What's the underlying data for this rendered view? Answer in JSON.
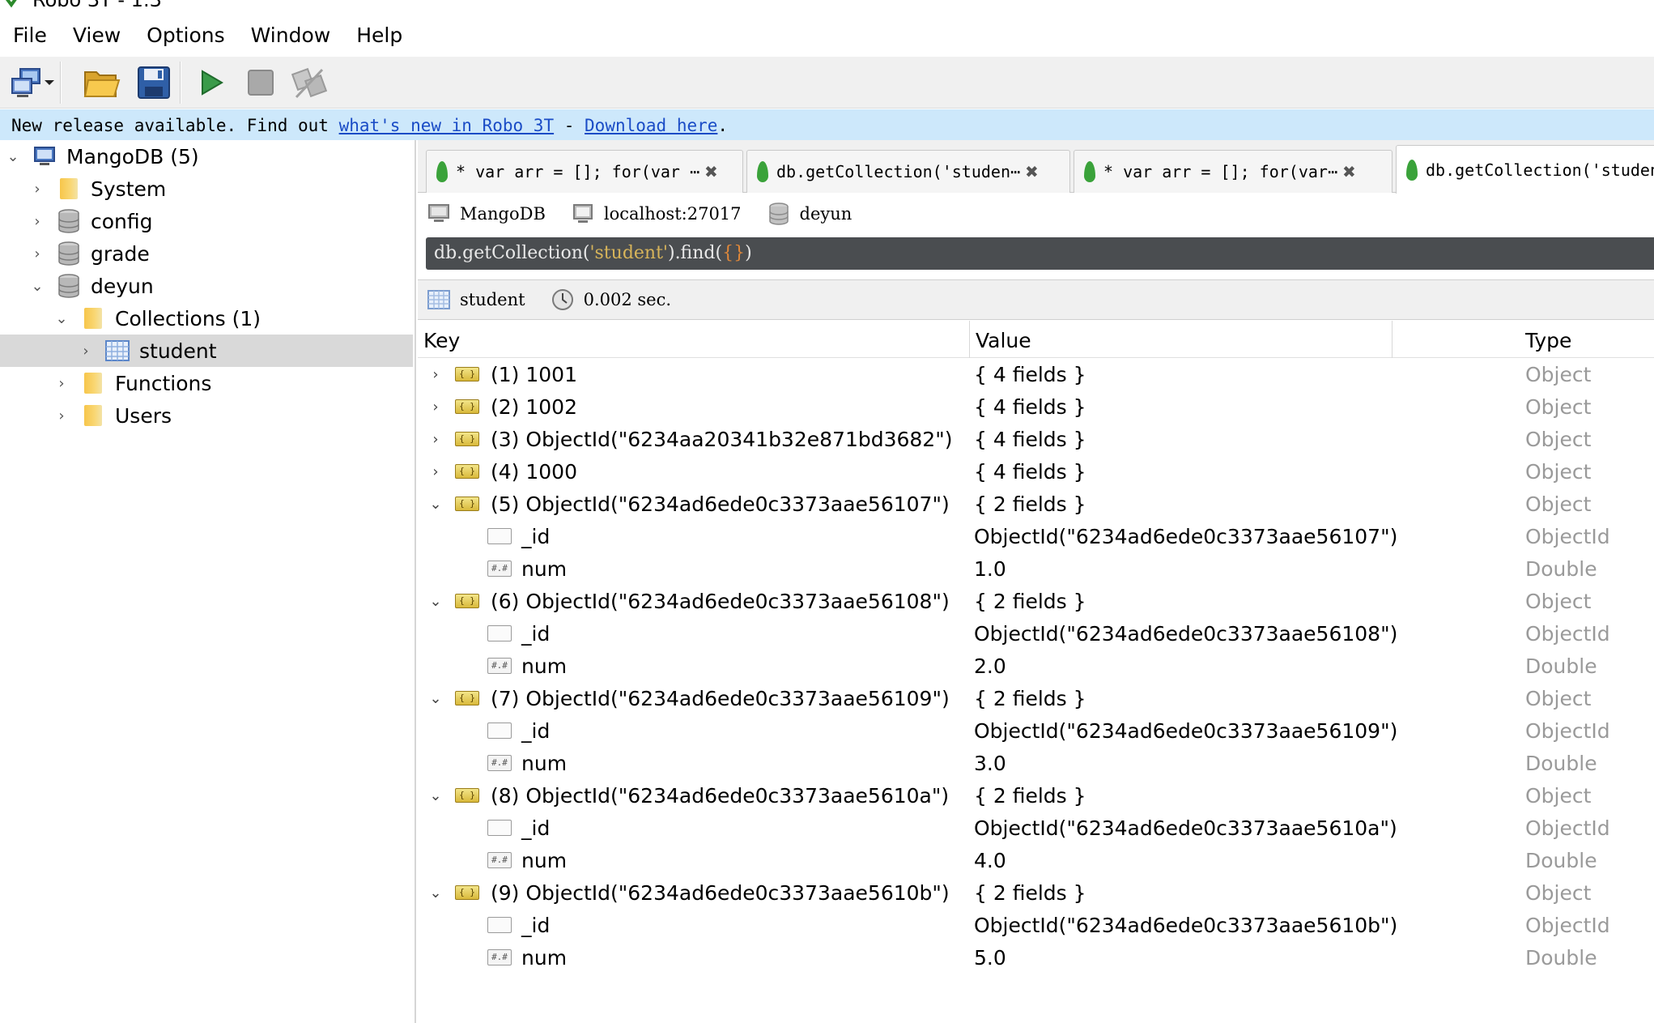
{
  "window": {
    "title": "Robo 3T - 1.3"
  },
  "menu": [
    "File",
    "View",
    "Options",
    "Window",
    "Help"
  ],
  "toolbar": {
    "buttons": [
      "connect-icon",
      "dropdown-arrow-icon",
      "open-folder-icon",
      "save-icon",
      "execute-icon",
      "stop-icon",
      "orientation-icon"
    ]
  },
  "notification": {
    "prefix": "New release available. Find out ",
    "link1": "what's new in Robo 3T",
    "separator": " - ",
    "link2": "Download here",
    "suffix": "."
  },
  "tree": {
    "server": "MangoDB (5)",
    "items": [
      {
        "label": "System",
        "icon": "folder-icon"
      },
      {
        "label": "config",
        "icon": "database-icon"
      },
      {
        "label": "grade",
        "icon": "database-icon"
      },
      {
        "label": "deyun",
        "icon": "database-icon"
      },
      {
        "label": "Collections (1)",
        "icon": "folder-icon"
      },
      {
        "label": "student",
        "icon": "collection-icon"
      },
      {
        "label": "Functions",
        "icon": "folder-icon"
      },
      {
        "label": "Users",
        "icon": "folder-icon"
      }
    ]
  },
  "tabs": [
    {
      "title": "* var arr = []; for(var ⋯"
    },
    {
      "title": "db.getCollection('studen⋯"
    },
    {
      "title": "* var arr = []; for(var⋯"
    },
    {
      "title": "db.getCollection('studen"
    }
  ],
  "connection": {
    "server": "MangoDB",
    "host": "localhost:27017",
    "database": "deyun"
  },
  "query": {
    "prefix": "db.getCollection(",
    "collection": "'student'",
    "mid": ").find(",
    "arg": "{}",
    "suffix": ")"
  },
  "result_info": {
    "collection": "student",
    "time": "0.002 sec."
  },
  "columns": {
    "key": "Key",
    "value": "Value",
    "type": "Type"
  },
  "rows": [
    {
      "key": "(1) 1001",
      "value": "{ 4 fields }",
      "type": "Object"
    },
    {
      "key": "(2) 1002",
      "value": "{ 4 fields }",
      "type": "Object"
    },
    {
      "key": "(3) ObjectId(\"6234aa20341b32e871bd3682\")",
      "value": "{ 4 fields }",
      "type": "Object"
    },
    {
      "key": "(4) 1000",
      "value": "{ 4 fields }",
      "type": "Object"
    },
    {
      "key": "(5) ObjectId(\"6234ad6ede0c3373aae56107\")",
      "value": "{ 2 fields }",
      "type": "Object"
    },
    {
      "key": "_id",
      "value": "ObjectId(\"6234ad6ede0c3373aae56107\")",
      "type": "ObjectId"
    },
    {
      "key": "num",
      "value": "1.0",
      "type": "Double"
    },
    {
      "key": "(6) ObjectId(\"6234ad6ede0c3373aae56108\")",
      "value": "{ 2 fields }",
      "type": "Object"
    },
    {
      "key": "_id",
      "value": "ObjectId(\"6234ad6ede0c3373aae56108\")",
      "type": "ObjectId"
    },
    {
      "key": "num",
      "value": "2.0",
      "type": "Double"
    },
    {
      "key": "(7) ObjectId(\"6234ad6ede0c3373aae56109\")",
      "value": "{ 2 fields }",
      "type": "Object"
    },
    {
      "key": "_id",
      "value": "ObjectId(\"6234ad6ede0c3373aae56109\")",
      "type": "ObjectId"
    },
    {
      "key": "num",
      "value": "3.0",
      "type": "Double"
    },
    {
      "key": "(8) ObjectId(\"6234ad6ede0c3373aae5610a\")",
      "value": "{ 2 fields }",
      "type": "Object"
    },
    {
      "key": "_id",
      "value": "ObjectId(\"6234ad6ede0c3373aae5610a\")",
      "type": "ObjectId"
    },
    {
      "key": "num",
      "value": "4.0",
      "type": "Double"
    },
    {
      "key": "(9) ObjectId(\"6234ad6ede0c3373aae5610b\")",
      "value": "{ 2 fields }",
      "type": "Object"
    },
    {
      "key": "_id",
      "value": "ObjectId(\"6234ad6ede0c3373aae5610b\")",
      "type": "ObjectId"
    },
    {
      "key": "num",
      "value": "5.0",
      "type": "Double"
    }
  ]
}
